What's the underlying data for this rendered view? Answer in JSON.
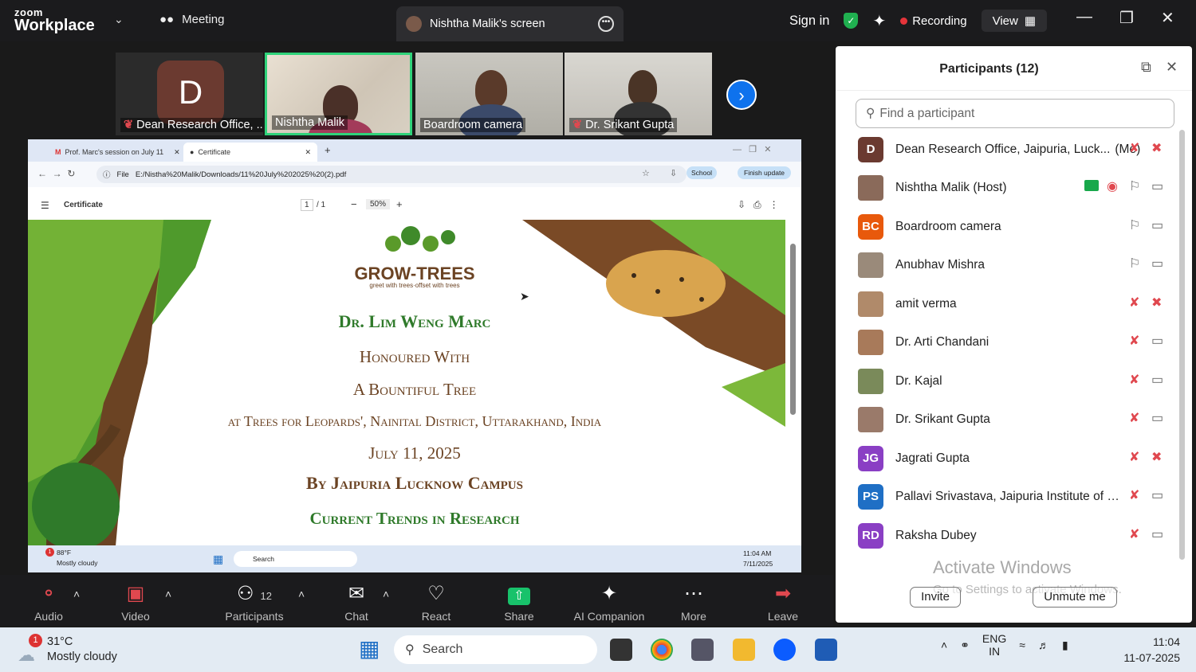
{
  "app": {
    "logo_top": "zoom",
    "logo_bottom": "Workplace",
    "meeting_label": "Meeting",
    "screen_tab": "Nishtha Malik's screen"
  },
  "topbar": {
    "signin": "Sign in",
    "recording": "Recording",
    "view": "View"
  },
  "videos": [
    {
      "initial": "D",
      "name": "Dean Research Office, ...",
      "muted": true
    },
    {
      "name": "Nishtha Malik",
      "muted": false
    },
    {
      "name": "Boardroom camera",
      "muted": false
    },
    {
      "name": "Dr. Srikant Gupta",
      "muted": true
    }
  ],
  "browser": {
    "tabs": [
      "Prof. Marc's session on July 11",
      "Certificate"
    ],
    "file_label": "File",
    "url": "E:/Nistha%20Malik/Downloads/11%20July%202025%20(2).pdf",
    "profile": "School",
    "finish_update": "Finish update",
    "pdf_title": "Certificate",
    "page_current": "1",
    "page_total": "/ 1",
    "zoom": "50%"
  },
  "certificate": {
    "logo": "GROW-TREES",
    "tagline": "greet with trees·offset with trees",
    "recipient": "Dr. Lim Weng Marc",
    "line1": "Honoured With",
    "line2": "A Bountiful Tree",
    "line3": "at Trees for Leopards', Nainital District, Uttarakhand, India",
    "date": "July 11, 2025",
    "by": "By Jaipuria Lucknow Campus",
    "topic": "Current Trends in Research"
  },
  "inner_taskbar": {
    "temp": "88°F",
    "cond": "Mostly cloudy",
    "search": "Search",
    "time": "11:04 AM",
    "date": "7/11/2025",
    "badge": "1"
  },
  "toolbar": {
    "audio": "Audio",
    "video": "Video",
    "participants": "Participants",
    "participants_count": "12",
    "chat": "Chat",
    "react": "React",
    "share": "Share",
    "ai": "AI Companion",
    "more": "More",
    "leave": "Leave"
  },
  "panel": {
    "title": "Participants (12)",
    "search_placeholder": "Find a participant",
    "participants": [
      {
        "initials": "D",
        "name": "Dean Research Office, Jaipuria, Luck...",
        "me": "(Me)",
        "color": "#6b3a30"
      },
      {
        "initials": "",
        "name": "Nishtha Malik (Host)",
        "color": "#8a6a5a"
      },
      {
        "initials": "BC",
        "name": "Boardroom camera",
        "color": "#e8590c"
      },
      {
        "initials": "",
        "name": "Anubhav Mishra",
        "color": "#9a8a7a"
      },
      {
        "initials": "",
        "name": "amit verma",
        "color": "#b08a6a"
      },
      {
        "initials": "",
        "name": "Dr. Arti Chandani",
        "color": "#a87a5a"
      },
      {
        "initials": "",
        "name": "Dr. Kajal",
        "color": "#7a8a5a"
      },
      {
        "initials": "",
        "name": "Dr. Srikant Gupta",
        "color": "#9a7a6a"
      },
      {
        "initials": "JG",
        "name": "Jagrati Gupta",
        "color": "#8a3fc4"
      },
      {
        "initials": "PS",
        "name": "Pallavi Srivastava, Jaipuria Institute of Ma...",
        "color": "#1f6fc5"
      },
      {
        "initials": "RD",
        "name": "Raksha Dubey",
        "color": "#8a3fc4"
      }
    ],
    "invite": "Invite",
    "unmute": "Unmute me",
    "activate_title": "Activate Windows",
    "activate_sub": "Go to Settings to activate Windows."
  },
  "taskbar": {
    "badge": "1",
    "temp": "31°C",
    "cond": "Mostly cloudy",
    "search": "Search",
    "lang1": "ENG",
    "lang2": "IN",
    "time": "11:04",
    "date": "11-07-2025"
  }
}
